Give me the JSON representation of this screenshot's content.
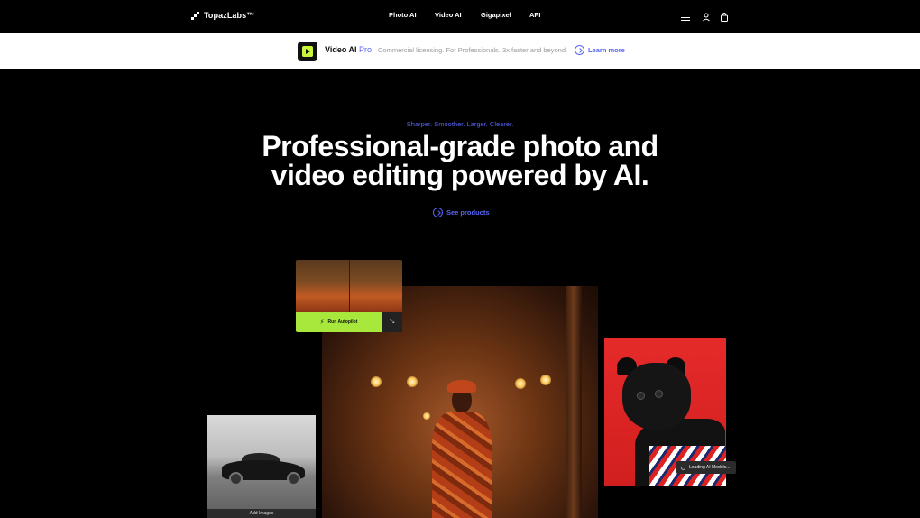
{
  "brand": {
    "name": "TopazLabs™"
  },
  "nav": {
    "links": [
      {
        "label": "Photo AI"
      },
      {
        "label": "Video AI"
      },
      {
        "label": "Gigapixel"
      },
      {
        "label": "API"
      }
    ],
    "icons": [
      "menu-icon",
      "user-icon",
      "cart-icon"
    ]
  },
  "banner": {
    "product": "Video AI",
    "tier": "Pro",
    "description": "Commercial licensing. For Professionals. 3x faster and beyond.",
    "cta": "Learn more"
  },
  "hero": {
    "eyebrow": "Sharper. Smoother. Larger. Clearer.",
    "headline_line1": "Professional-grade photo and",
    "headline_line2": "video editing powered by AI.",
    "cta": "See products"
  },
  "cards": {
    "autopilot_label": "Run Autopilot",
    "car_bar_label": "Add Images",
    "loading_label": "Loading AI Models..."
  },
  "colors": {
    "accent": "#5865f2",
    "lime": "#a8e83c",
    "banner_bg": "#ffffff",
    "page_bg": "#000000"
  }
}
